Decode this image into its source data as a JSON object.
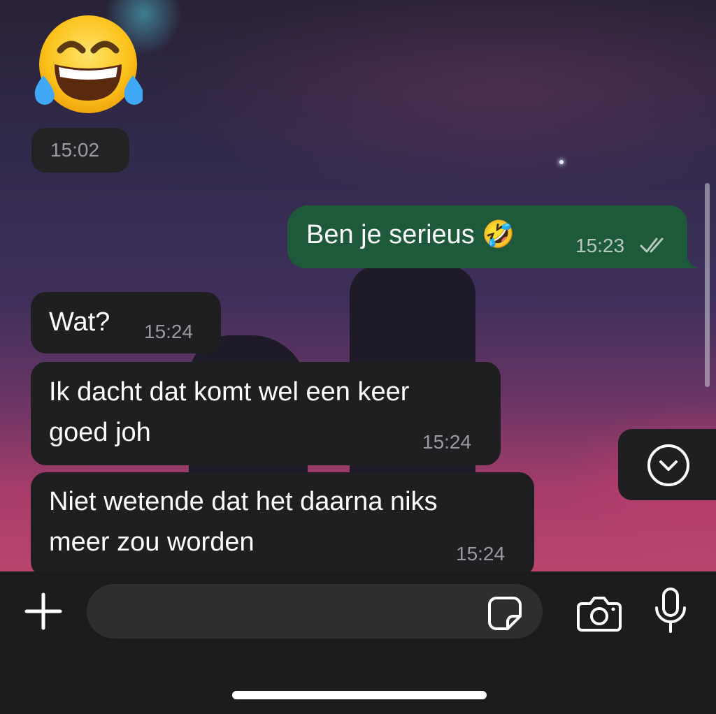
{
  "chat": {
    "emoji_message": {
      "emoji": "😂",
      "time": "15:02"
    },
    "outgoing": [
      {
        "text": "Ben je serieus 🤣",
        "time": "15:23",
        "status": "read"
      }
    ],
    "incoming": [
      {
        "lines": [
          "Wat?"
        ],
        "time": "15:24"
      },
      {
        "lines": [
          "Ik dacht dat komt wel een keer",
          "goed joh"
        ],
        "time": "15:24"
      },
      {
        "lines": [
          "Niet wetende dat het daarna niks",
          "meer zou worden"
        ],
        "time": "15:24"
      }
    ]
  },
  "composer": {
    "text_value": "",
    "icons": [
      "plus-icon",
      "sticker-icon",
      "camera-icon",
      "microphone-icon"
    ]
  },
  "colors": {
    "outgoing_bubble": "#1e5a3a",
    "incoming_bubble": "#1f1f21",
    "toolbar": "#1c1c1e"
  }
}
